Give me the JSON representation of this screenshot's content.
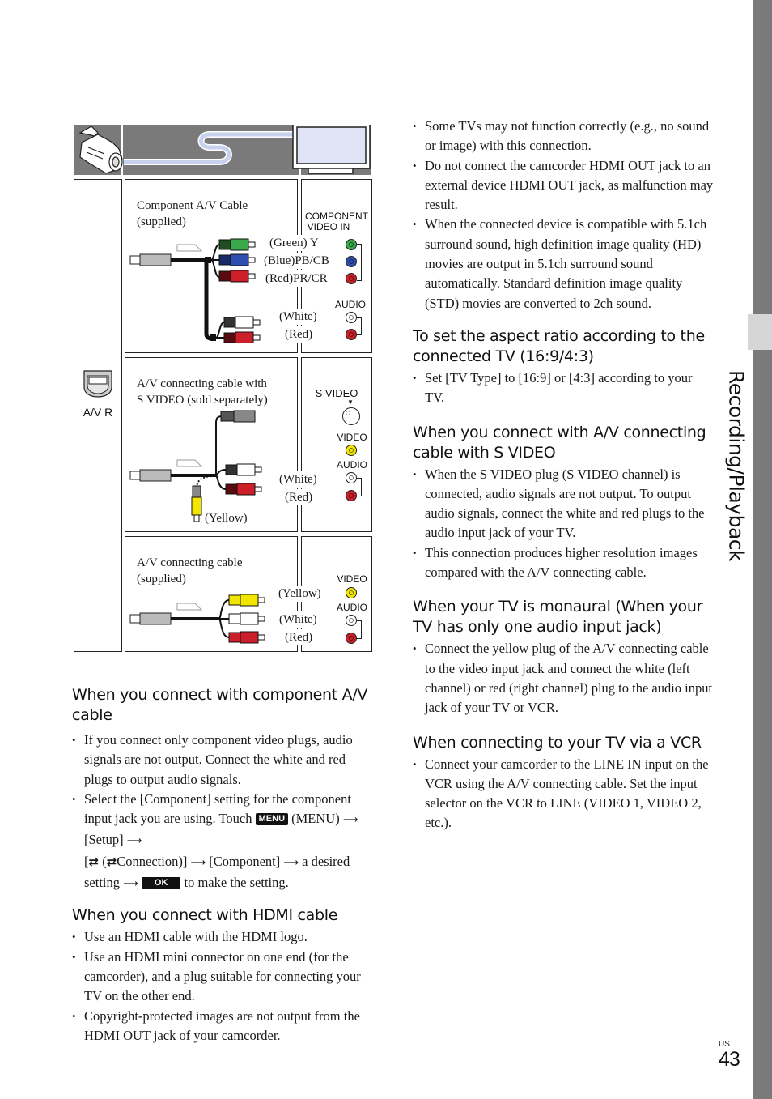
{
  "sidebar": {
    "section_label": "Recording/Playback"
  },
  "page": {
    "region": "US",
    "number": "43"
  },
  "diagram": {
    "connector_label": "A/V  R",
    "panels": [
      {
        "cable_label_line1": "Component A/V Cable",
        "cable_label_line2": "(supplied)",
        "tv_jack_title_line1": "COMPONENT",
        "tv_jack_title_line2": "VIDEO IN",
        "audio_label": "AUDIO",
        "plugs": [
          {
            "label": "(Green) Y",
            "color": "#3aa94b"
          },
          {
            "label": "(Blue)PB/CB",
            "color": "#2f4fb0"
          },
          {
            "label": "(Red)PR/CR",
            "color": "#cc1f2a"
          },
          {
            "label": "(White)",
            "color": "#ffffff"
          },
          {
            "label": "(Red)",
            "color": "#cc1f2a"
          }
        ]
      },
      {
        "cable_label_line1": "A/V connecting cable with",
        "cable_label_line2": "S VIDEO (sold separately)",
        "svideo_label": "S VIDEO",
        "video_label": "VIDEO",
        "audio_label": "AUDIO",
        "plugs": [
          {
            "label": "(White)",
            "color": "#ffffff"
          },
          {
            "label": "(Red)",
            "color": "#cc1f2a"
          },
          {
            "label": "(Yellow)",
            "color": "#f2e600"
          }
        ]
      },
      {
        "cable_label_line1": "A/V connecting cable",
        "cable_label_line2": "(supplied)",
        "video_label": "VIDEO",
        "audio_label": "AUDIO",
        "plugs": [
          {
            "label": "(Yellow)",
            "color": "#f2e600"
          },
          {
            "label": "(White)",
            "color": "#ffffff"
          },
          {
            "label": "(Red)",
            "color": "#cc1f2a"
          }
        ]
      }
    ]
  },
  "left_sections": [
    {
      "heading": "When you connect with component A/V cable",
      "bullet1": "If you connect only component video plugs, audio signals are not output. Connect the white and red plugs to output audio signals.",
      "bullet2_a": "Select the [Component] setting for the component input jack you are using. Touch",
      "menu_icon": "MENU",
      "bullet2_b": "(MENU)",
      "bullet2_c": "[Setup]",
      "bullet2_d": "Connection)]",
      "bullet2_e": "[Component]",
      "bullet2_f": "a desired setting",
      "ok_icon": "OK",
      "bullet2_g": "to make the setting."
    },
    {
      "heading": "When you connect with HDMI cable",
      "bullets": [
        "Use an HDMI cable with the HDMI logo.",
        "Use an HDMI mini connector on one end (for the camcorder), and a plug suitable for connecting your TV on the other end.",
        "Copyright-protected images are not output from the HDMI OUT jack of your camcorder."
      ]
    }
  ],
  "right_sections": [
    {
      "bullets": [
        "Some TVs may not function correctly (e.g., no sound or image) with this connection.",
        "Do not connect the camcorder HDMI OUT jack to an external device HDMI OUT jack, as malfunction may result.",
        "When the connected device is compatible with 5.1ch surround sound, high definition image quality (HD) movies are output in 5.1ch surround sound automatically. Standard definition image quality (STD) movies are converted to 2ch sound."
      ]
    },
    {
      "heading": "To set the aspect ratio according to the connected TV (16:9/4:3)",
      "bullets": [
        "Set [TV Type] to [16:9] or [4:3] according to your TV."
      ]
    },
    {
      "heading": "When you connect with A/V connecting cable with S VIDEO",
      "bullets": [
        "When the S VIDEO plug (S VIDEO channel) is connected, audio signals are not output. To output audio signals, connect the white and red plugs to the audio input jack of your TV.",
        "This connection produces higher resolution images compared with the A/V connecting cable."
      ]
    },
    {
      "heading": "When your TV is monaural (When your TV has only one audio input jack)",
      "bullets": [
        "Connect the yellow plug of the A/V connecting cable to the video input jack and connect the white (left channel) or red (right channel) plug to the audio input jack of your TV or VCR."
      ]
    },
    {
      "heading": "When connecting to your TV via a VCR",
      "bullets": [
        "Connect your camcorder to the LINE IN input on the VCR using the A/V connecting cable. Set the input selector on the VCR to LINE (VIDEO 1, VIDEO 2, etc.)."
      ]
    }
  ]
}
